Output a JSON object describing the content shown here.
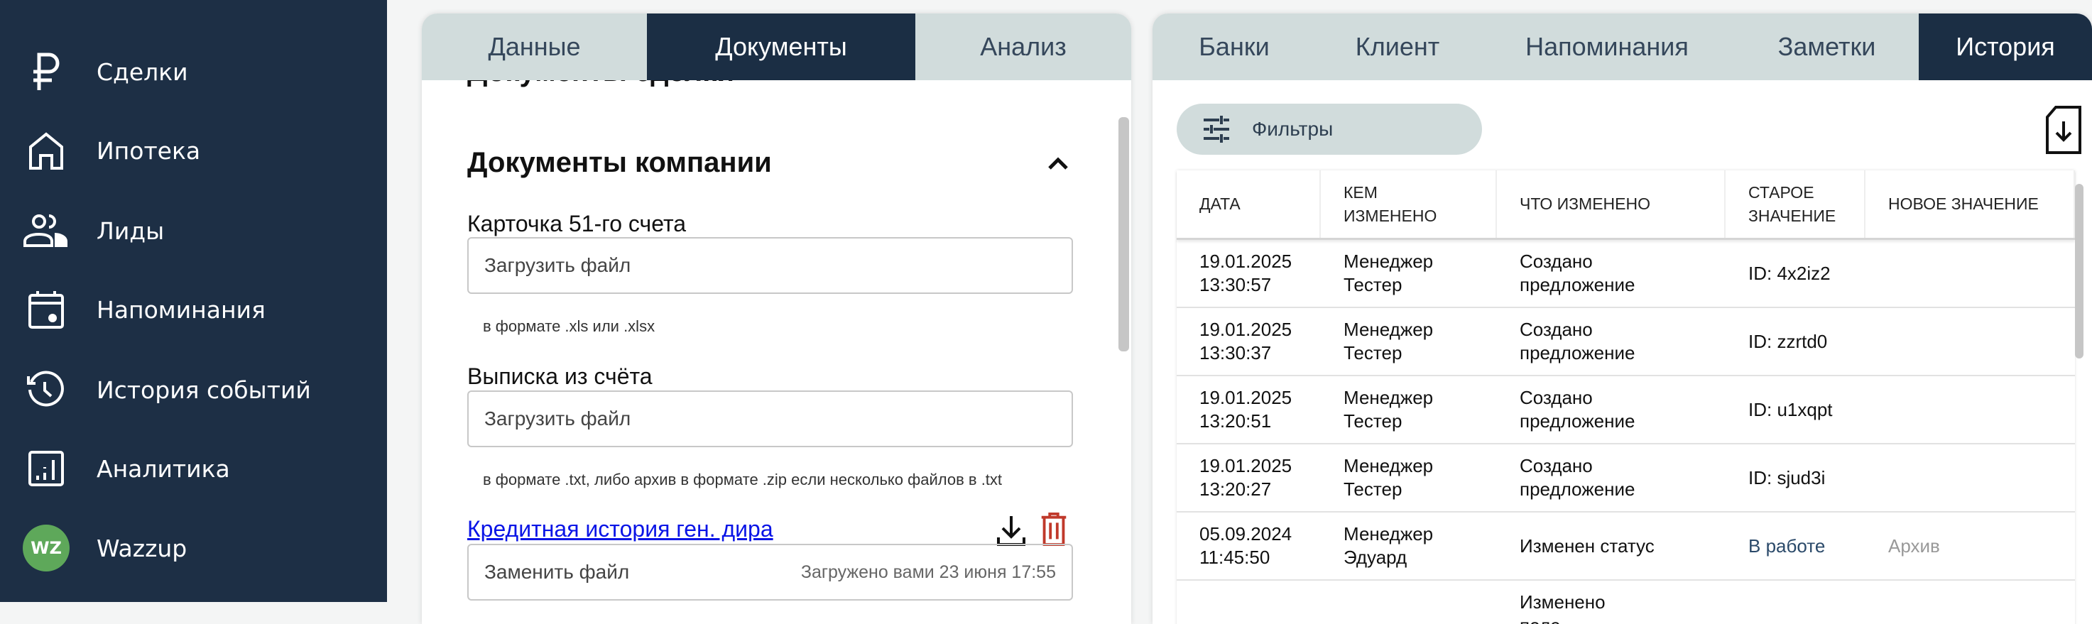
{
  "sidebar": {
    "items": [
      {
        "label": "Сделки",
        "icon": "ruble-icon"
      },
      {
        "label": "Ипотека",
        "icon": "house-icon"
      },
      {
        "label": "Лиды",
        "icon": "users-icon"
      },
      {
        "label": "Напоминания",
        "icon": "calendar-icon"
      },
      {
        "label": "История событий",
        "icon": "history-icon"
      },
      {
        "label": "Аналитика",
        "icon": "analytics-icon"
      },
      {
        "label": "Wazzup",
        "icon": "wazzup-logo",
        "badge": "WZ"
      }
    ]
  },
  "left_panel": {
    "tabs": [
      "Данные",
      "Документы",
      "Анализ"
    ],
    "active_tab": "Документы",
    "scrolled_title": "Документы сделки",
    "section_title": "Документы компании",
    "fields": [
      {
        "label": "Карточка 51-го счета",
        "placeholder": "Загрузить файл",
        "hint": "в формате .xls или .xlsx"
      },
      {
        "label": "Выписка из счёта",
        "placeholder": "Загрузить файл",
        "hint": "в формате .txt, либо архив в формате .zip если несколько файлов в .txt"
      }
    ],
    "uploaded": {
      "link": "Кредитная история ген. дира",
      "replace": "Заменить файл",
      "status": "Загружено вами 23 июня 17:55"
    }
  },
  "right_panel": {
    "tabs": [
      "Банки",
      "Клиент",
      "Напоминания",
      "Заметки",
      "История"
    ],
    "active_tab": "История",
    "filter_label": "Фильтры",
    "columns": [
      "ДАТА",
      "КЕМ ИЗМЕНЕНО",
      "ЧТО ИЗМЕНЕНО",
      "СТАРОЕ ЗНАЧЕНИЕ",
      "НОВОЕ ЗНАЧЕНИЕ"
    ],
    "rows": [
      {
        "date": "19.01.2025 13:30:57",
        "by": "Менеджер Тестер",
        "what": "Создано предложение",
        "old": "ID: 4x2iz2",
        "new": ""
      },
      {
        "date": "19.01.2025 13:30:37",
        "by": "Менеджер Тестер",
        "what": "Создано предложение",
        "old": "ID: zzrtd0",
        "new": ""
      },
      {
        "date": "19.01.2025 13:20:51",
        "by": "Менеджер Тестер",
        "what": "Создано предложение",
        "old": "ID: u1xqpt",
        "new": ""
      },
      {
        "date": "19.01.2025 13:20:27",
        "by": "Менеджер Тестер",
        "what": "Создано предложение",
        "old": "ID: sjud3i",
        "new": ""
      },
      {
        "date": "05.09.2024 11:45:50",
        "by": "Менеджер Эдуард",
        "what": "Изменен статус",
        "old": "В работе",
        "new": "Архив"
      },
      {
        "date": "",
        "by": "",
        "what": "Изменено поле",
        "old": "",
        "new": ""
      }
    ]
  },
  "colors": {
    "sidebar": "#1d2f45",
    "tab_bg": "#d1dcdc",
    "tab_active": "#1b2e44",
    "link": "#0a14e6",
    "trash": "#c0392b",
    "status_old": "#2b4a6a",
    "status_new": "#999999",
    "wazzup": "#5ea85a"
  }
}
